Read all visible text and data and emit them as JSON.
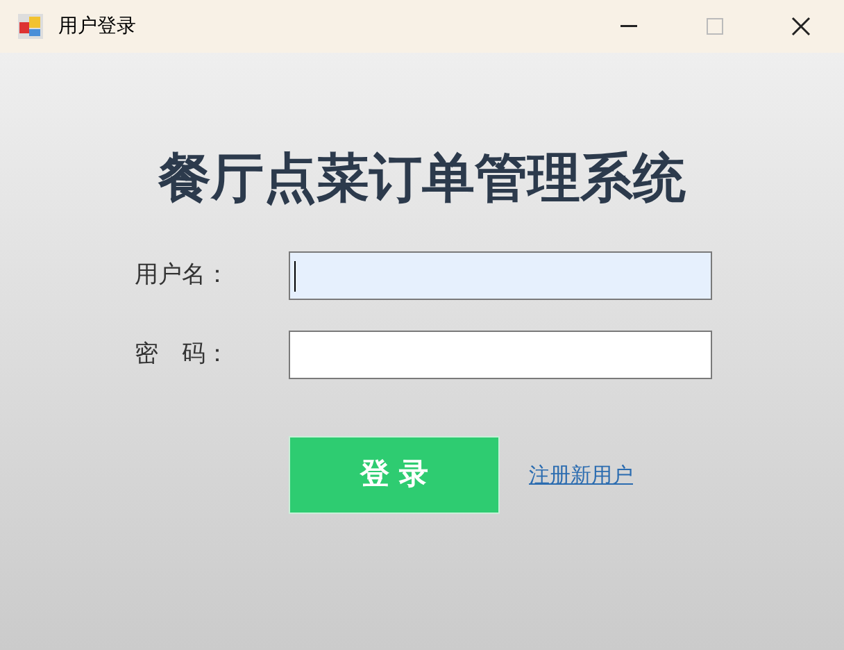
{
  "window": {
    "title": "用户登录"
  },
  "heading": "餐厅点菜订单管理系统",
  "fields": [
    {
      "label": "用户名：",
      "focused": true
    },
    {
      "label": "密　码：",
      "focused": false
    }
  ],
  "login_button": "登 录",
  "register_link": "注册新用户"
}
